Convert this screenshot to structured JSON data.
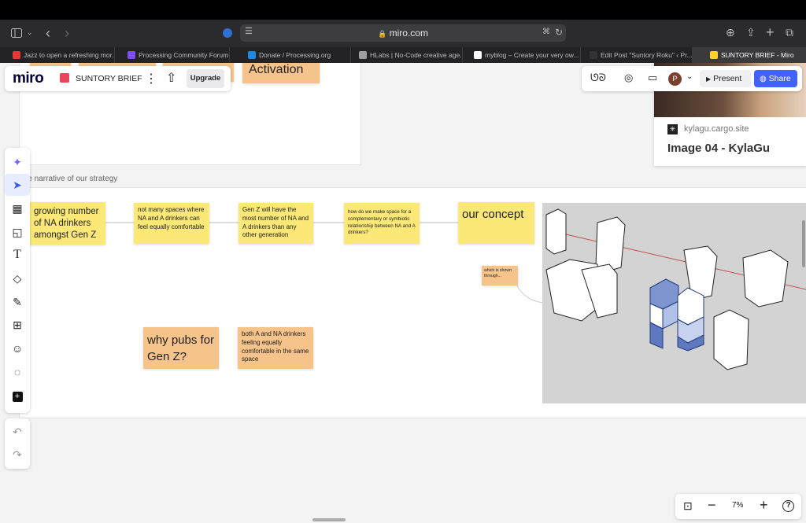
{
  "browser": {
    "url": "miro.com",
    "tabs": [
      {
        "label": "Jazz to open a refreshing mor...",
        "color": "#e53935",
        "active": false
      },
      {
        "label": "Processing Community Forum",
        "color": "#7c4dff",
        "active": false
      },
      {
        "label": "Donate / Processing.org",
        "color": "#1e88e5",
        "active": false
      },
      {
        "label": "HLabs | No-Code creative age...",
        "color": "#9e9e9e",
        "active": false
      },
      {
        "label": "myblog – Create your very ow...",
        "color": "#ffffff",
        "active": false
      },
      {
        "label": "Edit Post \"Suntory Roku\" ‹ Pr...",
        "color": "#333333",
        "active": false
      },
      {
        "label": "SUNTORY BRIEF - Miro",
        "color": "#ffd02f",
        "active": true
      }
    ]
  },
  "miro": {
    "logo": "miro",
    "board_name": "SUNTORY BRIEF",
    "upgrade_label": "Upgrade",
    "present_label": "Present",
    "share_label": "Share",
    "avatar_initial": "P",
    "zoom": "7%",
    "accent_color": "#4262ff"
  },
  "board": {
    "top_sticky": "Activation",
    "frame_title": "simple narrative of our strategy",
    "link_domain": "kylagu.cargo.site",
    "link_title": "Image 04 - KylaGu",
    "stickies": {
      "s1": "growing number of NA drinkers amongst Gen Z",
      "s2": "not many spaces where NA and A drinkers can feel equally comfortable",
      "s3": "Gen Z will have the most number of NA and A drinkers than any other generation",
      "s4": "how do we make space for a complementary or symbiotic relationship between NA and A drinkers?",
      "s5": "our concept",
      "s6": "which is shown through...",
      "s7": "why pubs for Gen Z?",
      "s8": "both A and NA drinkers feeling equally comfortable in the same space"
    }
  },
  "icons": {
    "sidebar": "sidebar-icon",
    "back": "chevron-left-icon",
    "forward": "chevron-right-icon",
    "download": "download-icon",
    "share_os": "share-icon",
    "new_tab": "plus-icon",
    "tabs_overview": "tabs-icon"
  }
}
